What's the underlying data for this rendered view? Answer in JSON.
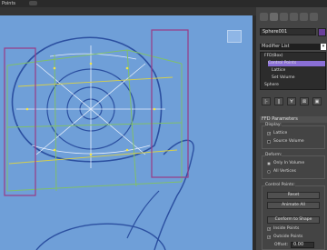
{
  "top_bar": {
    "title": "Points"
  },
  "object_name": "Sphere001",
  "modifier_list": {
    "label": "Modifier List",
    "dropdown_glyph": "▾"
  },
  "stack": {
    "items": [
      {
        "label": "FFD(Box)",
        "level": 0
      },
      {
        "label": "Control Points",
        "level": 1,
        "selected": true
      },
      {
        "label": "Lattice",
        "level": 1
      },
      {
        "label": "Set Volume",
        "level": 1
      },
      {
        "label": "Sphere",
        "level": 0
      }
    ]
  },
  "stack_buttons": [
    "|-",
    "‖",
    "∀",
    "⊠",
    "▣"
  ],
  "ffd_params": {
    "title": "FFD Parameters",
    "display_group": "Display:",
    "display_lattice": "Lattice",
    "display_source_volume": "Source Volume",
    "deform_group": "Deform:",
    "deform_only_in_volume": "Only In Volume",
    "deform_all_vertices": "All Vertices",
    "control_points_group": "Control Points:",
    "reset_label": "Reset",
    "animate_all_label": "Animate All",
    "conform_label": "Conform to Shape",
    "inside_points": "Inside Points",
    "outside_points": "Outside Points",
    "offset_label": "Offset:",
    "offset_value": "0.00"
  },
  "colors": {
    "viewport": "#6f9fd8",
    "selection": "#8a6fd6",
    "panel": "#444444"
  }
}
